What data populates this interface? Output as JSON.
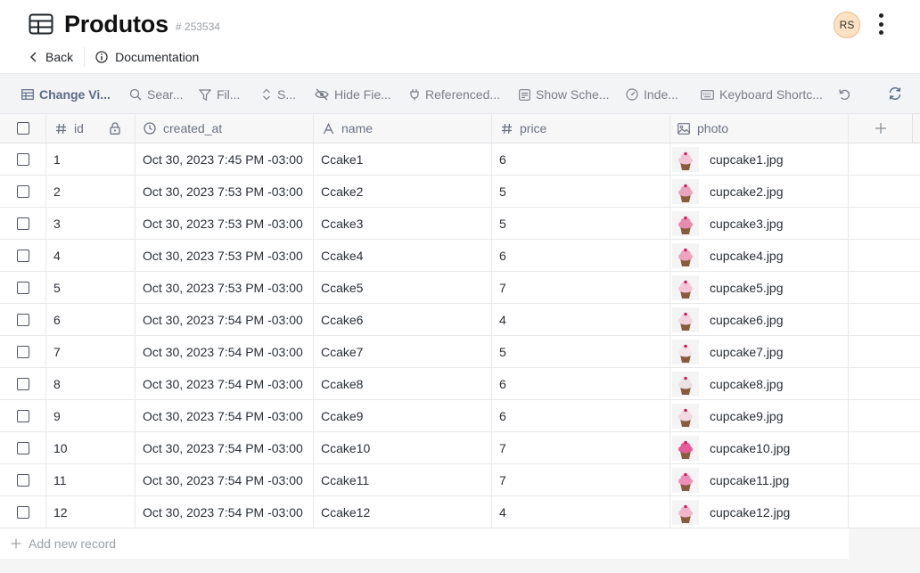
{
  "header": {
    "title": "Produtos",
    "table_id": "# 253534",
    "avatar_initials": "RS",
    "back_label": "Back",
    "docs_label": "Documentation"
  },
  "toolbar": {
    "change_view": "Change Vi...",
    "search": "Sear...",
    "filter": "Fil...",
    "sort": "S...",
    "hide_fields": "Hide Fie...",
    "referenced": "Referenced...",
    "show_schema": "Show Sche...",
    "indexes": "Inde...",
    "keyboard_shortcuts": "Keyboard Shortc..."
  },
  "columns": {
    "id": "id",
    "created_at": "created_at",
    "name": "name",
    "price": "price",
    "photo": "photo"
  },
  "rows": [
    {
      "id": "1",
      "created_at": "Oct 30, 2023 7:45 PM -03:00",
      "name": "Ccake1",
      "price": "6",
      "photo": "cupcake1.jpg",
      "frosting": "#f2c6d6"
    },
    {
      "id": "2",
      "created_at": "Oct 30, 2023 7:53 PM -03:00",
      "name": "Ccake2",
      "price": "5",
      "photo": "cupcake2.jpg",
      "frosting": "#e9a5bf"
    },
    {
      "id": "3",
      "created_at": "Oct 30, 2023 7:53 PM -03:00",
      "name": "Ccake3",
      "price": "5",
      "photo": "cupcake3.jpg",
      "frosting": "#e88bb0"
    },
    {
      "id": "4",
      "created_at": "Oct 30, 2023 7:53 PM -03:00",
      "name": "Ccake4",
      "price": "6",
      "photo": "cupcake4.jpg",
      "frosting": "#f0a3c0"
    },
    {
      "id": "5",
      "created_at": "Oct 30, 2023 7:53 PM -03:00",
      "name": "Ccake5",
      "price": "7",
      "photo": "cupcake5.jpg",
      "frosting": "#f5c4d8"
    },
    {
      "id": "6",
      "created_at": "Oct 30, 2023 7:54 PM -03:00",
      "name": "Ccake6",
      "price": "4",
      "photo": "cupcake6.jpg",
      "frosting": "#f2d3df"
    },
    {
      "id": "7",
      "created_at": "Oct 30, 2023 7:54 PM -03:00",
      "name": "Ccake7",
      "price": "5",
      "photo": "cupcake7.jpg",
      "frosting": "#f4e6ea"
    },
    {
      "id": "8",
      "created_at": "Oct 30, 2023 7:54 PM -03:00",
      "name": "Ccake8",
      "price": "6",
      "photo": "cupcake8.jpg",
      "frosting": "#e9e3e6"
    },
    {
      "id": "9",
      "created_at": "Oct 30, 2023 7:54 PM -03:00",
      "name": "Ccake9",
      "price": "6",
      "photo": "cupcake9.jpg",
      "frosting": "#f0dbe3"
    },
    {
      "id": "10",
      "created_at": "Oct 30, 2023 7:54 PM -03:00",
      "name": "Ccake10",
      "price": "7",
      "photo": "cupcake10.jpg",
      "frosting": "#e35b97"
    },
    {
      "id": "11",
      "created_at": "Oct 30, 2023 7:54 PM -03:00",
      "name": "Ccake11",
      "price": "7",
      "photo": "cupcake11.jpg",
      "frosting": "#ee8fb7"
    },
    {
      "id": "12",
      "created_at": "Oct 30, 2023 7:54 PM -03:00",
      "name": "Ccake12",
      "price": "4",
      "photo": "cupcake12.jpg",
      "frosting": "#f2b6cc"
    }
  ],
  "add_record_label": "Add new record"
}
